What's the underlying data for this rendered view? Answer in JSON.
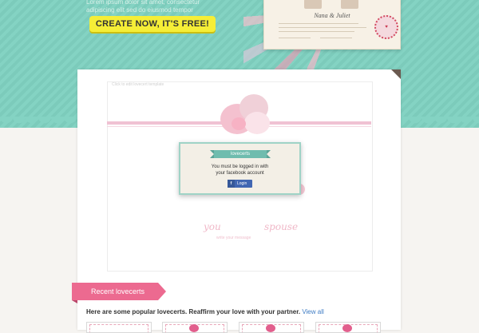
{
  "promo": {
    "body_text": "Lorem ipsum dolor sit amet, consectetur adipiscing elit sed do eiusmod tempor",
    "cta_label": "CREATE NOW, IT'S FREE!"
  },
  "sample_cert": {
    "names": "Nana & Juliet"
  },
  "editor": {
    "hint_text": "Click to edit lovecert template"
  },
  "login_modal": {
    "title": "lovecerts",
    "message_line1": "You must be logged in with",
    "message_line2": "your facebook account",
    "button_icon_letter": "f",
    "button_label": "Login"
  },
  "cert_preview": {
    "left_name": "you",
    "right_name": "spouse",
    "message_placeholder": "write your message"
  },
  "recent": {
    "tab_label": "Recent lovecerts",
    "intro_text": "Here are some popular lovecerts. Reaffirm your love with your partner.",
    "view_all_label": "View all"
  },
  "colors": {
    "teal_bg": "#84d3c3",
    "cta_yellow": "#f5ee37",
    "pink_accent": "#ec6a90",
    "facebook_blue": "#4166b2"
  }
}
